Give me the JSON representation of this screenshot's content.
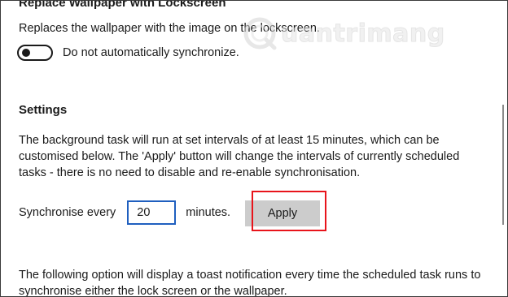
{
  "wallpaper_section": {
    "title": "Replace Wallpaper with Lockscreen",
    "description": "Replaces the wallpaper with the image on the lockscreen.",
    "toggle_state": "off",
    "toggle_label": "Do not automatically synchronize."
  },
  "settings": {
    "title": "Settings",
    "paragraph_lines": [
      "The background task will run at set intervals of at least 15 minutes, which can be",
      "customised below. The 'Apply' button will change the intervals of currently scheduled",
      "tasks - there is no need to disable and re-enable synchronisation."
    ],
    "sync_label": "Synchronise every",
    "sync_value": "20",
    "minutes_label": "minutes.",
    "apply_label": "Apply",
    "toast_paragraph_lines": [
      "The following option will display a toast notification every time the scheduled task runs to",
      "synchronise either the lock screen or the wallpaper."
    ]
  },
  "watermark": {
    "text": "uantrimang",
    "icon": "quantrimang-logo-icon"
  },
  "colors": {
    "highlight_box": "#e8141b",
    "input_border": "#1f5fbf",
    "button_bg": "#cccccc"
  }
}
